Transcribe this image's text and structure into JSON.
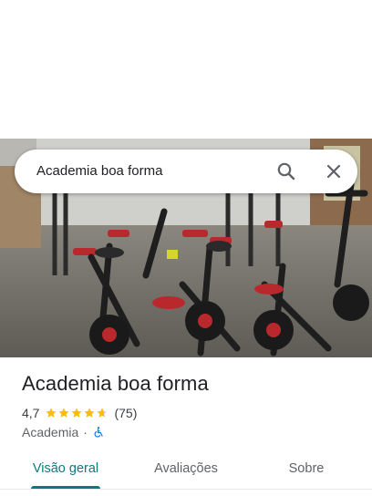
{
  "search": {
    "query": "Academia boa forma",
    "search_icon": "search-icon",
    "close_icon": "close-icon"
  },
  "photo": {
    "subject": "gym-interior-photo"
  },
  "place": {
    "name": "Academia boa forma",
    "rating": "4,7",
    "rating_value": 4.7,
    "reviews": "(75)",
    "category": "Academia",
    "separator": "·",
    "accessibility_icon": "wheelchair-icon"
  },
  "tabs": [
    {
      "label": "Visão geral",
      "active": true
    },
    {
      "label": "Avaliações",
      "active": false
    },
    {
      "label": "Sobre",
      "active": false
    }
  ],
  "colors": {
    "accent": "#0b7a7f",
    "star": "#fbbc04",
    "accessibility": "#1a73e8"
  }
}
